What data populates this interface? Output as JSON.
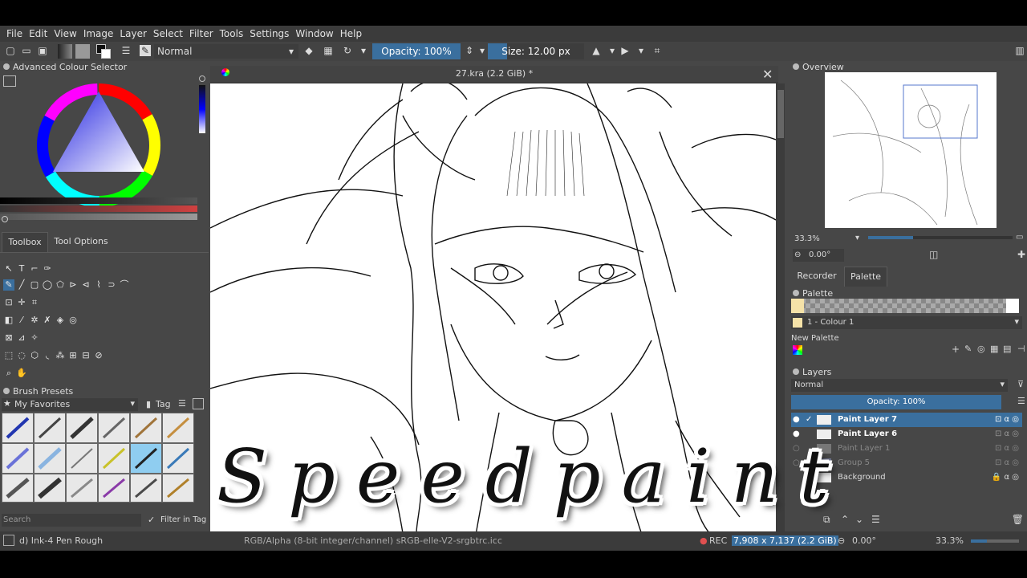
{
  "menu": [
    "File",
    "Edit",
    "View",
    "Image",
    "Layer",
    "Select",
    "Filter",
    "Tools",
    "Settings",
    "Window",
    "Help"
  ],
  "toolbar": {
    "blend_mode": "Normal",
    "opacity": "Opacity: 100%",
    "size": "Size: 12.00 px"
  },
  "colour_selector": {
    "title": "Advanced Colour Selector"
  },
  "tool_tabs": {
    "toolbox": "Toolbox",
    "tool_options": "Tool Options"
  },
  "brush_presets": {
    "title": "Brush Presets",
    "favorites": "My Favorites",
    "tag": "Tag",
    "search_placeholder": "Search",
    "filter_label": "Filter in Tag"
  },
  "document": {
    "title": "27.kra (2.2 GiB) *"
  },
  "overview": {
    "title": "Overview",
    "zoom": "33.3%",
    "rotation": "0.00°"
  },
  "recorder_tabs": {
    "recorder": "Recorder",
    "palette": "Palette"
  },
  "palette": {
    "title": "Palette",
    "colour_name": "1 - Colour 1",
    "new_palette": "New Palette"
  },
  "layers": {
    "title": "Layers",
    "blend_mode": "Normal",
    "opacity": "Opacity:  100%",
    "items": [
      {
        "name": "Paint Layer 7",
        "active": true
      },
      {
        "name": "Paint Layer 6",
        "active": false
      },
      {
        "name": "Paint Layer 1",
        "active": false
      },
      {
        "name": "Group 5",
        "active": false
      },
      {
        "name": "Background",
        "active": false
      }
    ]
  },
  "status": {
    "brush": "d) Ink-4 Pen Rough",
    "colorspace": "RGB/Alpha (8-bit integer/channel)  sRGB-elle-V2-srgbtrc.icc",
    "rec": "REC",
    "dimensions": "7,908 x 7,137 (2.2 GiB)",
    "rotation": "0.00°",
    "zoom": "33.3%"
  },
  "overlay_title": "Speedpaint",
  "colors": {
    "accent": "#3a6f9e",
    "panel": "#474747",
    "menubar": "#3b3b3b"
  }
}
